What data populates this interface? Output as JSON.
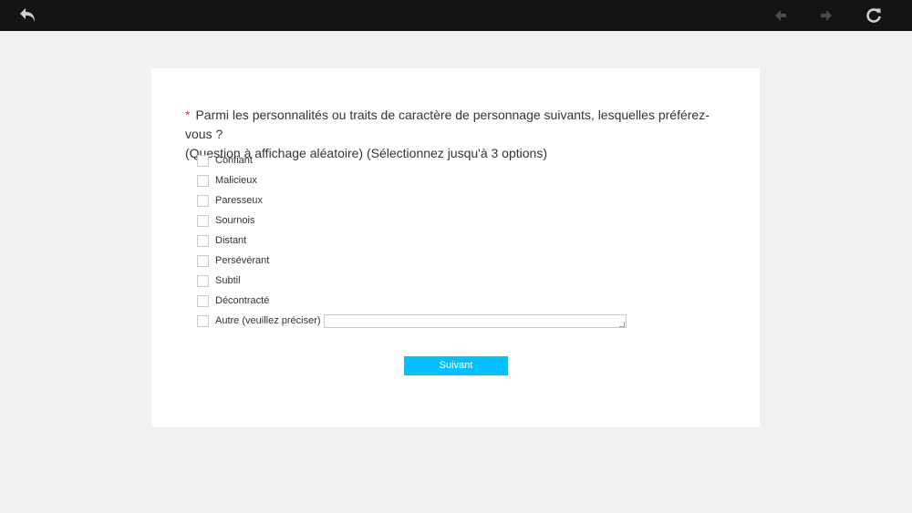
{
  "toolbar": {
    "icons": {
      "back": "undo-arrow-icon",
      "prev": "previous-arrow-icon",
      "next": "next-arrow-icon",
      "reload": "reload-icon"
    },
    "colors": {
      "bar": "#141414",
      "icon_active": "#cfcfcf",
      "icon_disabled": "#4a4a4a"
    }
  },
  "survey": {
    "required_marker": "*",
    "question_line1": "Parmi les personnalités ou traits de caractère de personnage suivants, lesquelles préférez-vous ?",
    "question_line2": "(Question à affichage aléatoire)  (Sélectionnez jusqu'à 3 options)",
    "options": [
      {
        "label": "Confiant",
        "checked": false
      },
      {
        "label": "Malicieux",
        "checked": false
      },
      {
        "label": "Paresseux",
        "checked": false
      },
      {
        "label": "Sournois",
        "checked": false
      },
      {
        "label": "Distant",
        "checked": false
      },
      {
        "label": "Persévérant",
        "checked": false
      },
      {
        "label": "Subtil",
        "checked": false
      },
      {
        "label": "Décontracté",
        "checked": false
      },
      {
        "label": "Autre (veuillez préciser)",
        "checked": false
      }
    ],
    "other_input_value": "",
    "next_label": "Suivant",
    "colors": {
      "accent": "#00c0ff",
      "required": "#e4393c",
      "background": "#f1f1f1",
      "card": "#ffffff"
    }
  }
}
